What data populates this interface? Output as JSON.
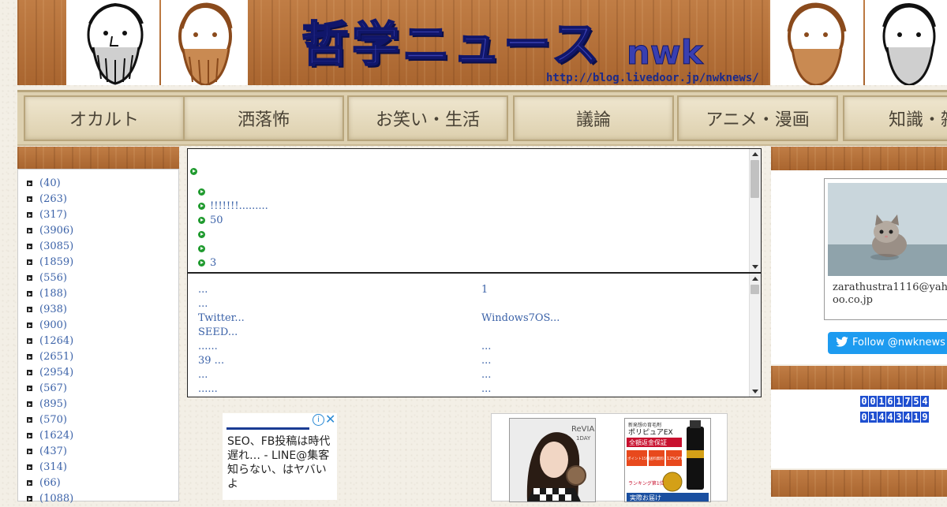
{
  "header": {
    "title": "哲学ニュース",
    "subtitle": "nwk",
    "url": "http://blog.livedoor.jp/nwknews/"
  },
  "nav": {
    "items": [
      {
        "label": "オカルト"
      },
      {
        "label": "洒落怖"
      },
      {
        "label": "お笑い・生活"
      },
      {
        "label": "議論"
      },
      {
        "label": "アニメ・漫画"
      },
      {
        "label": "知識・雑"
      }
    ]
  },
  "categories": {
    "counts": [
      "(40)",
      "(263)",
      "(317)",
      "(3906)",
      "(3085)",
      "(1859)",
      "(556)",
      "(188)",
      "(938)",
      "(900)",
      "(1264)",
      "(2651)",
      "(2954)",
      "(567)",
      "(895)",
      "(570)",
      "(1624)",
      "(437)",
      "(314)",
      "(66)",
      "(1088)"
    ]
  },
  "feed_panel": {
    "rows": [
      "",
      "",
      "!!!!!!!.........",
      "50",
      "",
      "",
      "3"
    ]
  },
  "links_panel": {
    "left": [
      "...",
      "...",
      "Twitter...",
      "SEED...",
      "......",
      "39 ...",
      "...",
      "......"
    ],
    "right": [
      "1",
      "",
      "Windows7OS...",
      "",
      "...",
      "...",
      "...",
      "..."
    ]
  },
  "ad_text": {
    "text": "SEO、FB投稿は時代遅れ… - LINE@集客知らない、はヤバいよ"
  },
  "ad_products": {
    "brand": "ReVIA",
    "brand_sub": "1DAY",
    "prod_top": "新発想の育毛剤",
    "prod_name": "ポリピュアEX",
    "prod_banner": "全額返金保証",
    "badge1": "ポイント15倍",
    "badge2": "送料無料",
    "badge3": "12%OFF",
    "rank": "ランキング第1位",
    "bottom": "実際お届け"
  },
  "profile": {
    "email": "zarathustra1116@yahoo.co.jp",
    "follow_label": "Follow @nwknews"
  },
  "counters": {
    "total": "00161754",
    "yesterday": "01443419"
  },
  "colors": {
    "title_blue": "#3a3fb0",
    "link": "#3b62a8",
    "bullet_green": "#1f9a2e",
    "twitter_blue": "#1d9bf0",
    "wood": "#b4703a"
  }
}
